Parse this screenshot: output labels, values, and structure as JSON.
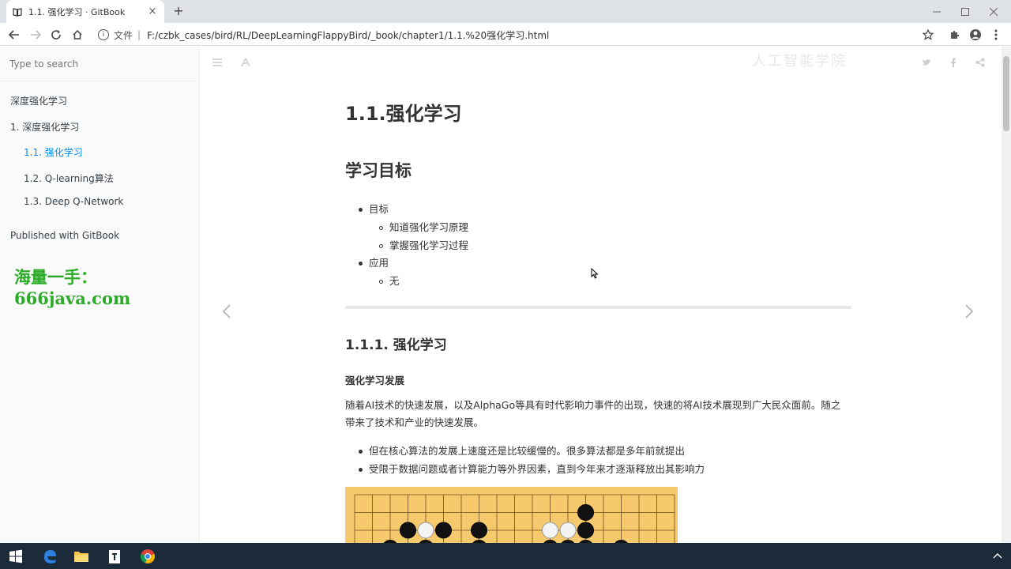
{
  "browser": {
    "tab_title": "1.1. 强化学习 · GitBook",
    "close_tab": "×",
    "new_tab": "+",
    "address_prefix": "文件",
    "address_separator": "|",
    "url": "F:/czbk_cases/bird/RL/DeepLearningFlappyBird/_book/chapter1/1.1.%20强化学习.html",
    "watermark_text": "人工智能学院"
  },
  "sidebar": {
    "search_placeholder": "Type to search",
    "items": [
      {
        "label": "深度强化学习"
      },
      {
        "label": "1. 深度强化学习"
      },
      {
        "label": "1.1. 强化学习"
      },
      {
        "label": "1.2. Q-learning算法"
      },
      {
        "label": "1.3. Deep Q-Network"
      },
      {
        "label": "Published with GitBook"
      }
    ],
    "watermark": "海量一手：666java.com"
  },
  "content": {
    "h1": "1.1.强化学习",
    "h2": "学习目标",
    "list": [
      {
        "text": "目标",
        "level": 1
      },
      {
        "text": "知道强化学习原理",
        "level": 2
      },
      {
        "text": "掌握强化学习过程",
        "level": 2
      },
      {
        "text": "应用",
        "level": 1
      },
      {
        "text": "无",
        "level": 2
      }
    ],
    "h3": "1.1.1. 强化学习",
    "h4": "强化学习发展",
    "paragraph": "随着AI技术的快速发展，以及AlphaGo等具有时代影响力事件的出现，快速的将AI技术展现到广大民众面前。随之带来了技术和产业的快速发展。",
    "bullets": [
      "但在核心算法的发展上速度还是比较缓慢的。很多算法都是多年前就提出",
      "受限于数据问题或者计算能力等外界因素，直到今年来才逐渐释放出其影响力"
    ]
  },
  "colors": {
    "active_link": "#008cff",
    "watermark_green": "#2bab27",
    "board": "#f5c96c",
    "taskbar": "#1c2b3a"
  }
}
